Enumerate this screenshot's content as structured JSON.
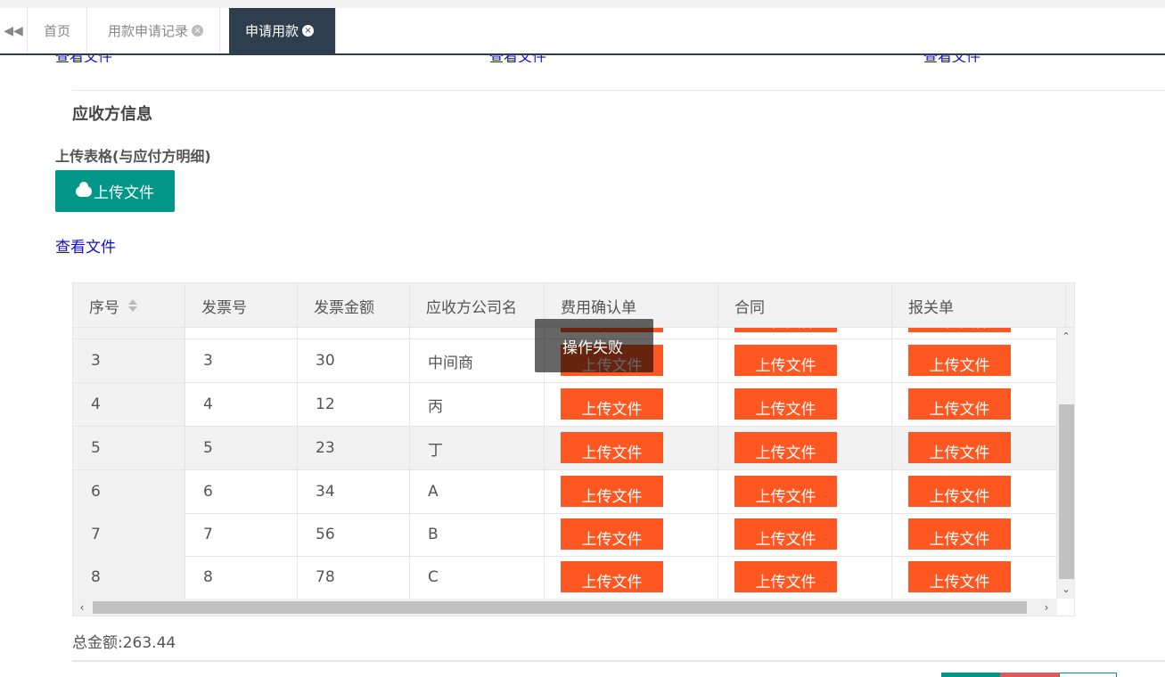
{
  "tabs": {
    "back_icon": "double-chevron-left-icon",
    "items": [
      {
        "label": "首页"
      },
      {
        "label": "用款申请记录",
        "close": "×"
      },
      {
        "label": "申请用款",
        "close": "×"
      }
    ]
  },
  "top_links": [
    "查看文件",
    "查看文件",
    "查看文件"
  ],
  "section": {
    "title": "应收方信息",
    "upload_label": "上传表格(与应付方明细)",
    "upload_button": "上传文件",
    "view_file": "查看文件"
  },
  "table": {
    "headers": [
      "序号",
      "发票号",
      "发票金额",
      "应收方公司名",
      "费用确认单",
      "合同",
      "报关单"
    ],
    "button_label": "上传文件",
    "rows": [
      {
        "seq": "3",
        "invoice_no": "3",
        "amount": "30",
        "company": "中间商"
      },
      {
        "seq": "4",
        "invoice_no": "4",
        "amount": "12",
        "company": "丙"
      },
      {
        "seq": "5",
        "invoice_no": "5",
        "amount": "23",
        "company": "丁"
      },
      {
        "seq": "6",
        "invoice_no": "6",
        "amount": "34",
        "company": "A"
      },
      {
        "seq": "7",
        "invoice_no": "7",
        "amount": "56",
        "company": "B"
      },
      {
        "seq": "8",
        "invoice_no": "8",
        "amount": "78",
        "company": "C"
      }
    ]
  },
  "total": {
    "label": "总金额:",
    "value": "263.44"
  },
  "toast": "操作失败",
  "colors": {
    "primary": "#009688",
    "danger": "#ff5722",
    "tab_active": "#2f3e4c",
    "link": "#1010c8"
  }
}
